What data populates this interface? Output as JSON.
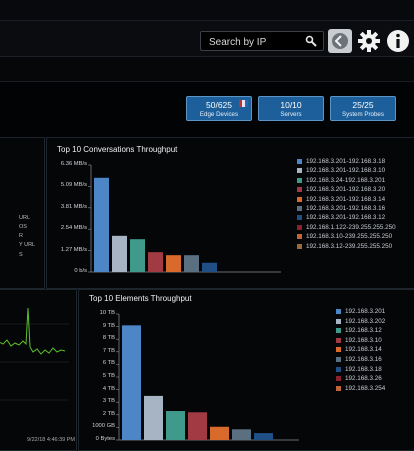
{
  "header": {
    "search_placeholder": "Search by IP",
    "icons": [
      "search-icon",
      "circle-arrow-icon",
      "gear-icon",
      "info-icon"
    ]
  },
  "tiles": [
    {
      "count": "50/625",
      "label": "Edge Devices"
    },
    {
      "count": "10/10",
      "label": "Servers"
    },
    {
      "count": "25/25",
      "label": "System Probes"
    }
  ],
  "conversations": {
    "title": "Top 10 Conversations Throughput",
    "chart_data": {
      "type": "bar",
      "y_ticks": [
        "6.36 MB/s",
        "5.09 MB/s",
        "3.81 MB/s",
        "2.54 MB/s",
        "1.27 MB/s",
        "0 b/s"
      ],
      "ylim": [
        0,
        6.36
      ],
      "legend_placement": "right",
      "series": [
        {
          "name": "192.168.3.201-192.168.3.18",
          "value": 5.6,
          "color": "#4d86c6"
        },
        {
          "name": "192.168.3.201-192.168.3.10",
          "value": 2.15,
          "color": "#a7b4c4"
        },
        {
          "name": "192.168.3.24-192.168.3.201",
          "value": 1.95,
          "color": "#3f9a8b"
        },
        {
          "name": "192.168.3.201-192.168.3.20",
          "value": 1.18,
          "color": "#a23a43"
        },
        {
          "name": "192.168.3.201-192.168.3.14",
          "value": 1.0,
          "color": "#d86b2c"
        },
        {
          "name": "192.168.3.201-192.168.3.16",
          "value": 1.0,
          "color": "#5a6f7f"
        },
        {
          "name": "192.168.3.201-192.168.3.12",
          "value": 0.55,
          "color": "#1f4f85"
        },
        {
          "name": "192.168.1.122-239.255.255.250",
          "value": 0,
          "color": "#8a2030"
        },
        {
          "name": "192.168.3.10-239.255.255.250",
          "value": 0,
          "color": "#c2653a"
        },
        {
          "name": "192.168.3.12-239.255.255.250",
          "value": 0,
          "color": "#9a6a3a"
        }
      ]
    }
  },
  "elements": {
    "title": "Top 10 Elements Throughput",
    "chart_data": {
      "type": "bar",
      "y_ticks": [
        "10 TB",
        "9 TB",
        "8 TB",
        "7 TB",
        "6 TB",
        "5 TB",
        "4 TB",
        "3 TB",
        "2 TB",
        "1000 GB",
        "0 Bytes"
      ],
      "ylim": [
        0,
        10
      ],
      "legend_placement": "right",
      "series": [
        {
          "name": "192.168.3.201",
          "value": 9.1,
          "color": "#4d86c6"
        },
        {
          "name": "192.168.3.202",
          "value": 3.5,
          "color": "#a7b4c4"
        },
        {
          "name": "192.168.3.12",
          "value": 2.3,
          "color": "#3f9a8b"
        },
        {
          "name": "192.168.3.10",
          "value": 2.2,
          "color": "#a23a43"
        },
        {
          "name": "192.168.3.14",
          "value": 1.05,
          "color": "#d86b2c"
        },
        {
          "name": "192.168.3.16",
          "value": 0.85,
          "color": "#5a6f7f"
        },
        {
          "name": "192.168.3.18",
          "value": 0.55,
          "color": "#1f4f85"
        },
        {
          "name": "192.168.3.26",
          "value": 0,
          "color": "#8a2030"
        },
        {
          "name": "192.168.3.254",
          "value": 0,
          "color": "#c2653a"
        }
      ]
    }
  },
  "left_panel": {
    "list_fragments": [
      "",
      "",
      "",
      "",
      "URL",
      "OS",
      "R",
      "Y URL",
      "S"
    ],
    "timestamp": "9/22/18 4:46:39 PM"
  }
}
